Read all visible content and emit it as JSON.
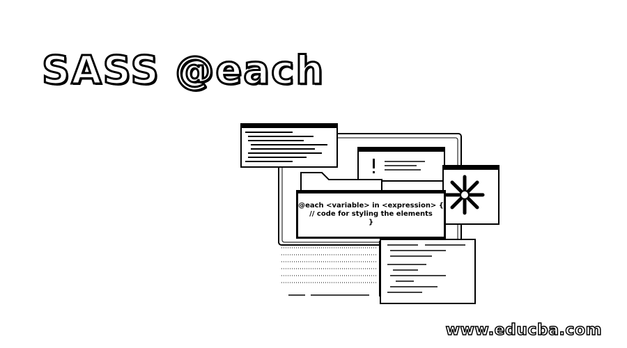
{
  "title": "SASS @each",
  "code": {
    "line1": "@each <variable> in <expression> {",
    "line2": "// code for styling the elements",
    "line3": "}"
  },
  "watermark": "www.educba.com",
  "icons": {
    "alert": "exclamation-icon",
    "gear": "asterisk-gear-icon"
  }
}
